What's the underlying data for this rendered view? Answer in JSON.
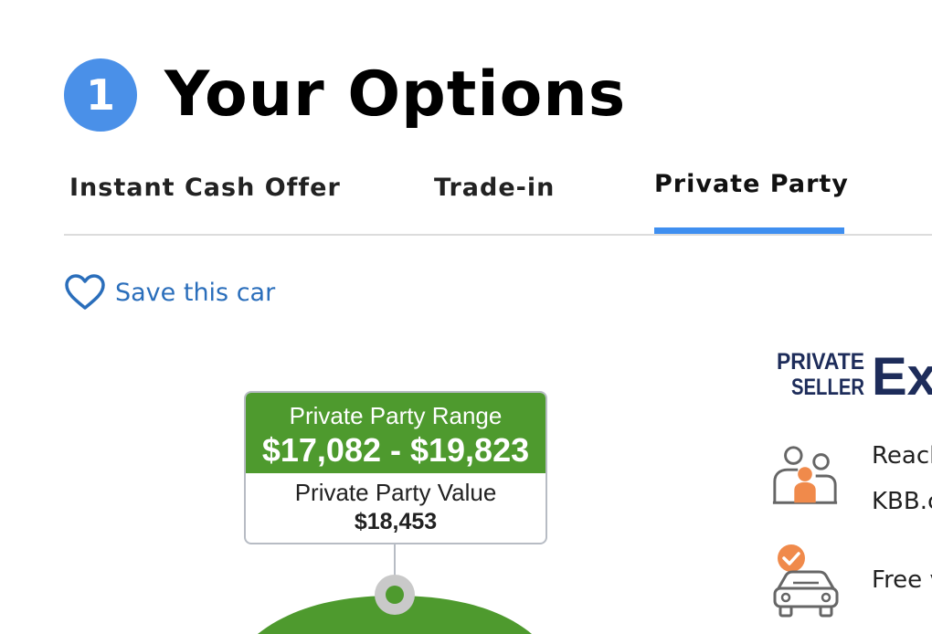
{
  "step": {
    "number": "1",
    "title": "Your Options"
  },
  "tabs": [
    {
      "label": "Instant Cash Offer"
    },
    {
      "label": "Trade-in"
    },
    {
      "label": "Private Party",
      "active": true
    }
  ],
  "save": {
    "label": "Save this car",
    "icon": "heart-icon"
  },
  "valuation": {
    "range_label": "Private Party Range",
    "range_values": "$17,082 - $19,823",
    "value_label": "Private Party Value",
    "value_amount": "$18,453"
  },
  "promo": {
    "logo_line1": "PRIVATE",
    "logo_line2": "SELLER",
    "logo_word": "Exc",
    "features": [
      {
        "icon": "people-icon",
        "text_line1": "Reacl",
        "text_line2": "KBB.c"
      },
      {
        "icon": "car-check-icon",
        "text_line1": "Free v"
      }
    ]
  },
  "colors": {
    "badge": "#4a90e8",
    "tab_indicator": "#3f8ff0",
    "link": "#2a6ebb",
    "range_header": "#4e9a2e",
    "brand_navy": "#1d2c5a",
    "accent_orange": "#f08a4b"
  }
}
